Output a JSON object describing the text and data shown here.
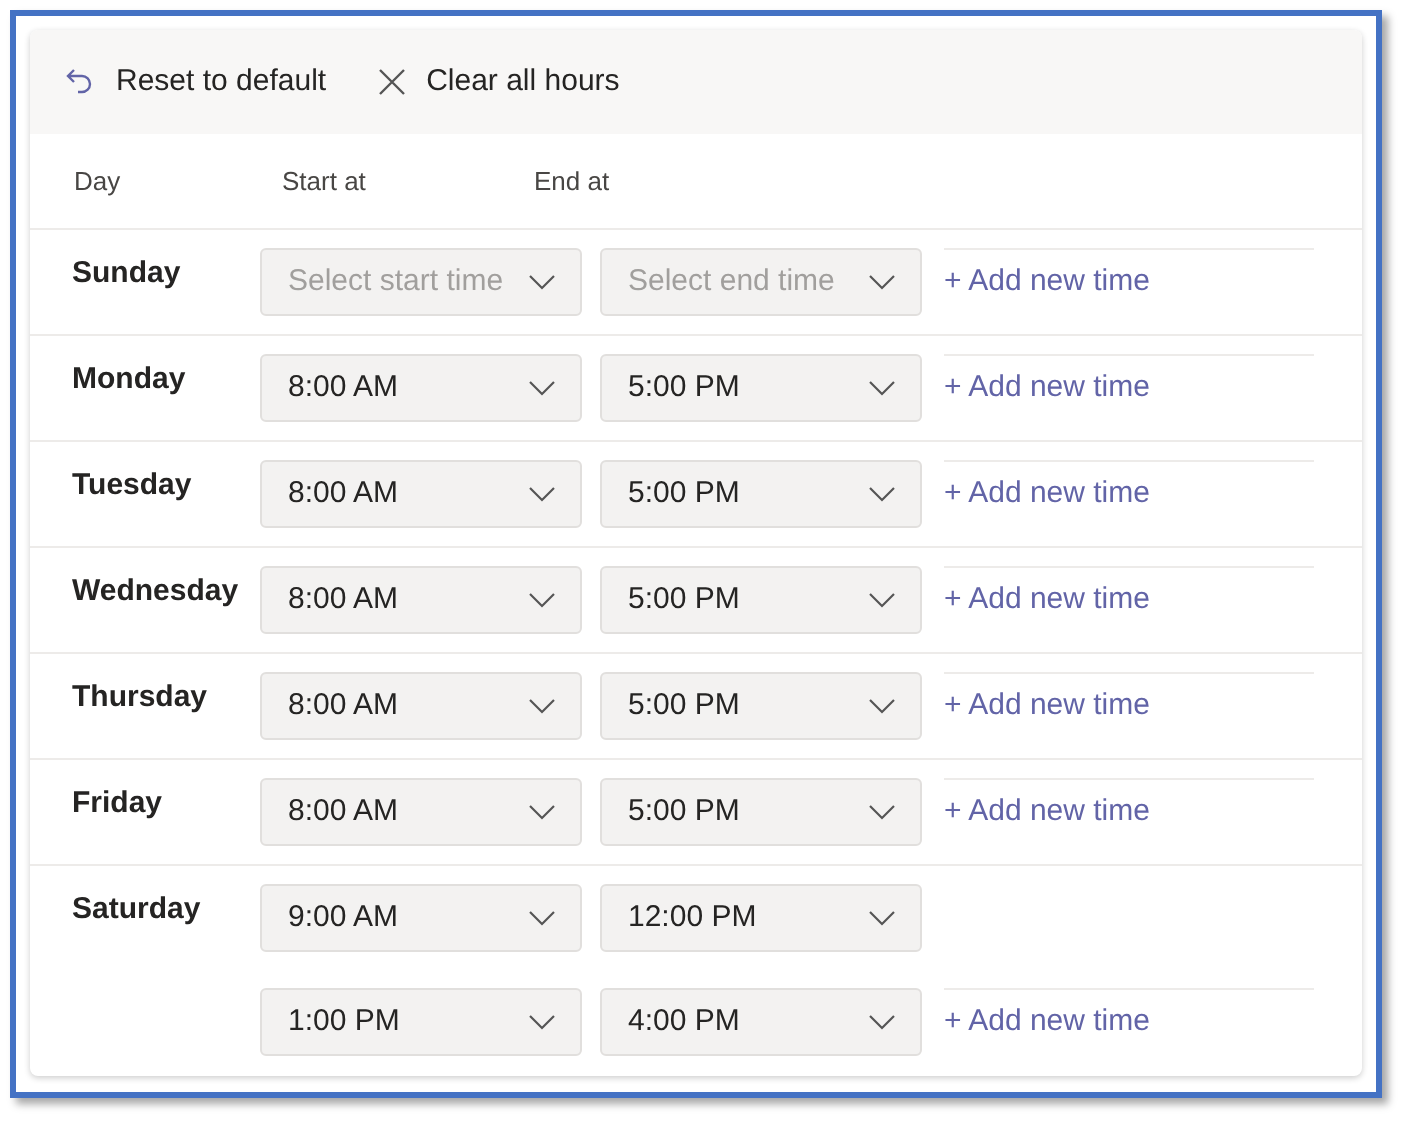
{
  "toolbar": {
    "reset": "Reset to default",
    "clear": "Clear all hours"
  },
  "columns": [
    "Day",
    "Start at",
    "End at"
  ],
  "days": [
    {
      "name": "Sunday",
      "add_link": "+ Add new time",
      "slots": [
        {
          "start": {
            "placeholder": "Select start time"
          },
          "end": {
            "placeholder": "Select end time"
          }
        }
      ]
    },
    {
      "name": "Monday",
      "add_link": "+ Add new time",
      "slots": [
        {
          "start": {
            "value": "8:00 AM"
          },
          "end": {
            "value": "5:00 PM"
          }
        }
      ]
    },
    {
      "name": "Tuesday",
      "add_link": "+ Add new time",
      "slots": [
        {
          "start": {
            "value": "8:00 AM"
          },
          "end": {
            "value": "5:00 PM"
          }
        }
      ]
    },
    {
      "name": "Wednesday",
      "add_link": "+ Add new time",
      "slots": [
        {
          "start": {
            "value": "8:00 AM"
          },
          "end": {
            "value": "5:00 PM"
          }
        }
      ]
    },
    {
      "name": "Thursday",
      "add_link": "+ Add new time",
      "slots": [
        {
          "start": {
            "value": "8:00 AM"
          },
          "end": {
            "value": "5:00 PM"
          }
        }
      ]
    },
    {
      "name": "Friday",
      "add_link": "+ Add new time",
      "slots": [
        {
          "start": {
            "value": "8:00 AM"
          },
          "end": {
            "value": "5:00 PM"
          }
        }
      ]
    },
    {
      "name": "Saturday",
      "add_link": "+ Add new time",
      "slots": [
        {
          "start": {
            "value": "9:00 AM"
          },
          "end": {
            "value": "12:00 PM"
          }
        },
        {
          "start": {
            "value": "1:00 PM"
          },
          "end": {
            "value": "4:00 PM"
          }
        }
      ]
    }
  ]
}
